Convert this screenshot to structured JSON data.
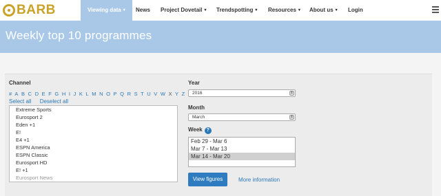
{
  "brand": {
    "name": "BARB",
    "color": "#c9a227"
  },
  "nav": {
    "items": [
      {
        "label": "Viewing data",
        "dropdown": true,
        "active": true
      },
      {
        "label": "News",
        "dropdown": false
      },
      {
        "label": "Project Dovetail",
        "dropdown": true
      },
      {
        "label": "Trendspotting",
        "dropdown": true
      },
      {
        "label": "Resources",
        "dropdown": true
      },
      {
        "label": "About us",
        "dropdown": true
      },
      {
        "label": "Login",
        "dropdown": false
      }
    ],
    "caret": "▾"
  },
  "banner": {
    "title": "Weekly top 10 programmes",
    "color": "#a9c8e8"
  },
  "channel": {
    "label": "Channel",
    "alphabet": [
      "#",
      "A",
      "B",
      "C",
      "D",
      "E",
      "F",
      "G",
      "H",
      "I",
      "J",
      "K",
      "L",
      "M",
      "N",
      "O",
      "P",
      "Q",
      "R",
      "S",
      "T",
      "U",
      "V",
      "W",
      "X",
      "Y",
      "Z"
    ],
    "select_all": "Select all",
    "deselect_all": "Deselect all",
    "items": [
      "Extreme Sports",
      "Eurosport 2",
      "Eden +1",
      "E!",
      "E4 +1",
      "ESPN America",
      "ESPN Classic",
      "Eurosport HD",
      "E! +1",
      "Eurosport News"
    ]
  },
  "year": {
    "label": "Year",
    "value": "2016"
  },
  "month": {
    "label": "Month",
    "value": "March"
  },
  "week": {
    "label": "Week",
    "help": "?",
    "items": [
      "Feb 29 - Mar 6",
      "Mar 7 - Mar 13",
      "Mar 14 - Mar 20"
    ],
    "selected_index": 2
  },
  "actions": {
    "view": "View figures",
    "more": "More information"
  },
  "colors": {
    "accent": "#2e7bc0",
    "link": "#2a78b8"
  }
}
